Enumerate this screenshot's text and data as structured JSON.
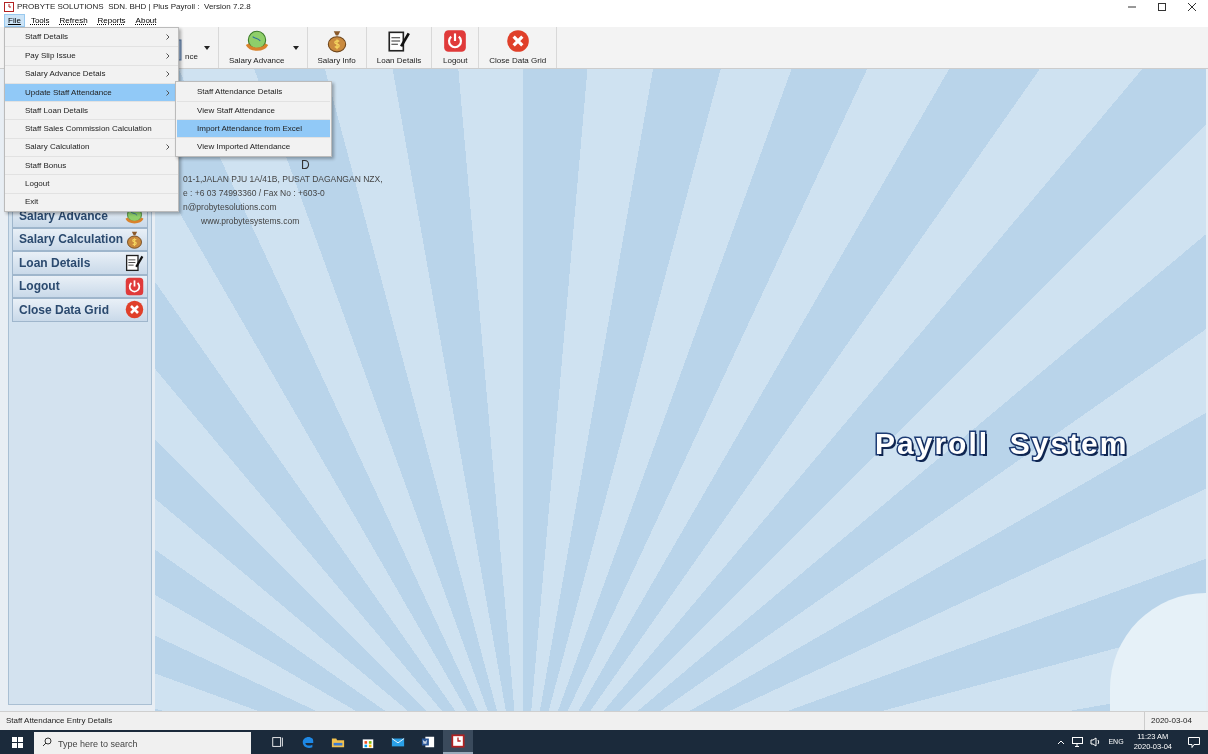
{
  "window": {
    "title": "PROBYTE SOLUTIONS  SDN. BHD | Plus Payroll :  Version 7.2.8"
  },
  "menu_bar": [
    {
      "label": "File",
      "selected": true
    },
    {
      "label": "Tools",
      "selected": false
    },
    {
      "label": "Refresh",
      "selected": false
    },
    {
      "label": "Reports",
      "selected": false
    },
    {
      "label": "About",
      "selected": false
    }
  ],
  "toolbar": [
    {
      "label": "nce",
      "kind": "partial",
      "dropdown": true
    },
    {
      "label": "Salary Advance",
      "kind": "globe",
      "dropdown": true
    },
    {
      "label": "Salary Info",
      "kind": "moneybag",
      "dropdown": false
    },
    {
      "label": "Loan Details",
      "kind": "document",
      "dropdown": false
    },
    {
      "label": "Logout",
      "kind": "power",
      "dropdown": false
    },
    {
      "label": "Close Data Grid",
      "kind": "close",
      "dropdown": false
    }
  ],
  "file_menu": [
    {
      "label": "Staff Details",
      "has_submenu": true,
      "selected": false
    },
    {
      "label": "Pay Slip Issue",
      "has_submenu": true,
      "selected": false
    },
    {
      "label": "Salary Advance Detais",
      "has_submenu": true,
      "selected": false
    },
    {
      "label": "Update Staff Attendance",
      "has_submenu": true,
      "selected": true
    },
    {
      "label": "Staff Loan Details",
      "has_submenu": false,
      "selected": false
    },
    {
      "label": "Staff Sales Commission Calculation",
      "has_submenu": false,
      "selected": false
    },
    {
      "label": "Salary Calculation",
      "has_submenu": true,
      "selected": false
    },
    {
      "label": "Staff Bonus",
      "has_submenu": false,
      "selected": false
    },
    {
      "label": "Logout",
      "has_submenu": false,
      "selected": false
    },
    {
      "label": "Exit",
      "has_submenu": false,
      "selected": false
    }
  ],
  "submenu": [
    {
      "label": "Staff Attendance Details",
      "selected": false
    },
    {
      "label": "View Staff Attendance",
      "selected": false
    },
    {
      "label": "Import Attendance from Excel",
      "selected": true
    },
    {
      "label": "View Imported Attendance",
      "selected": false
    }
  ],
  "sidebar": [
    {
      "label": "Salary Advance",
      "kind": "globe"
    },
    {
      "label": "Salary Calculation",
      "kind": "moneybag"
    },
    {
      "label": "Loan Details",
      "kind": "document"
    },
    {
      "label": "Logout",
      "kind": "power"
    },
    {
      "label": "Close Data Grid",
      "kind": "close"
    }
  ],
  "company": {
    "heading": "D",
    "lines": [
      "01-1,JALAN PJU 1A/41B, PUSAT DAGANGAN NZX,",
      "e : +6 03 74993360 / Fax No : +603-0",
      "n@probytesolutions.com",
      "www.probytesystems.com"
    ]
  },
  "logo_text": "Payroll  System",
  "status_bar": {
    "message": "Staff Attendance Entry Details",
    "date": "2020-03-04"
  },
  "taskbar": {
    "search_placeholder": "Type here to search",
    "apps": [
      {
        "kind": "taskview",
        "selected": false
      },
      {
        "kind": "browser",
        "selected": false
      },
      {
        "kind": "folder",
        "selected": false
      },
      {
        "kind": "store",
        "selected": false
      },
      {
        "kind": "mail",
        "selected": false
      },
      {
        "kind": "word",
        "selected": false
      },
      {
        "kind": "payroll",
        "selected": true
      }
    ],
    "language": "ENG",
    "time": "11:23 AM",
    "date": "2020-03-04"
  }
}
